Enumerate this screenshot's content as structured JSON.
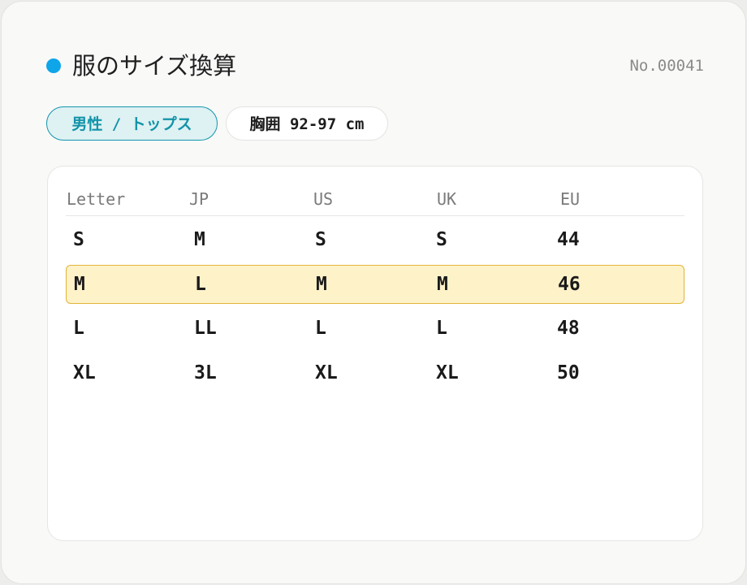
{
  "header": {
    "title": "服のサイズ換算",
    "serial": "No.00041",
    "accent_color": "#0ea5e9"
  },
  "chips": {
    "category": "男性 / トップス",
    "chest": "胸囲 92-97 cm"
  },
  "table": {
    "columns": [
      "Letter",
      "JP",
      "US",
      "UK",
      "EU"
    ],
    "rows": [
      [
        "S",
        "M",
        "S",
        "S",
        "44"
      ],
      [
        "M",
        "L",
        "M",
        "M",
        "46"
      ],
      [
        "L",
        "LL",
        "L",
        "L",
        "48"
      ],
      [
        "XL",
        "3L",
        "XL",
        "XL",
        "50"
      ]
    ],
    "highlight_color": "#fef2c9"
  }
}
